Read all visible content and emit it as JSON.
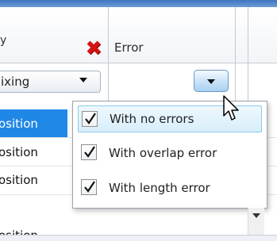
{
  "header": {
    "left_label": "y",
    "error_label": "Error"
  },
  "combo": {
    "value": "ixing"
  },
  "rows": [
    {
      "text": "osition",
      "selected": true
    },
    {
      "text": "osition",
      "selected": false
    },
    {
      "text": "osition",
      "selected": false
    },
    {
      "text": "osition",
      "selected": false
    }
  ],
  "dropdown": {
    "items": [
      {
        "label": "With no errors",
        "checked": true,
        "hover": true
      },
      {
        "label": "With overlap error",
        "checked": true,
        "hover": false
      },
      {
        "label": "With length error",
        "checked": true,
        "hover": false
      }
    ]
  },
  "icons": {
    "remove": "remove-filter-icon",
    "filter": "chevron-down-icon",
    "cursor": "mouse-pointer-icon"
  },
  "colors": {
    "selection": "#1f87e6",
    "remove_x": "#d41414",
    "hover_border": "#8ec9ea"
  }
}
